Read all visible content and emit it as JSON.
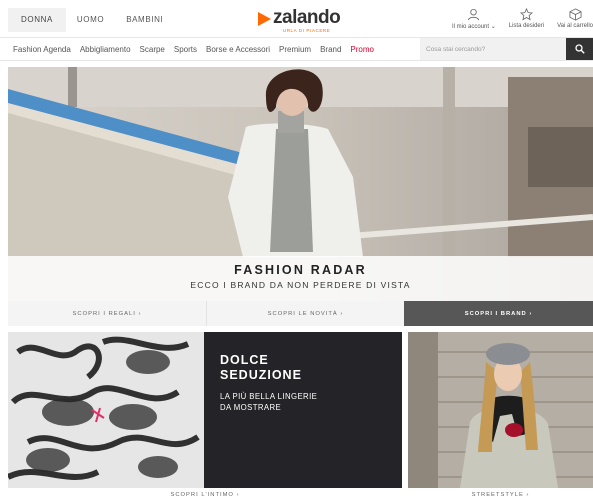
{
  "gender_tabs": [
    {
      "label": "DONNA",
      "active": true
    },
    {
      "label": "UOMO",
      "active": false
    },
    {
      "label": "BAMBINI",
      "active": false
    }
  ],
  "logo": {
    "text": "zalando",
    "subtitle": "URLA DI PIACERE",
    "color": "#ff6900"
  },
  "utilities": [
    {
      "label": "Il mio account",
      "icon": "user-icon"
    },
    {
      "label": "Lista desideri",
      "icon": "star-icon"
    },
    {
      "label": "Vai al carrello",
      "icon": "bag-icon"
    }
  ],
  "categories": [
    "Fashion Agenda",
    "Abbigliamento",
    "Scarpe",
    "Sports",
    "Borse e Accessori",
    "Premium",
    "Brand",
    "Promo"
  ],
  "search": {
    "placeholder": "Cosa stai cercando?",
    "button_icon": "search-icon"
  },
  "hero": {
    "title": "FASHION RADAR",
    "subtitle": "ECCO I BRAND DA NON PERDERE DI VISTA",
    "links": [
      "SCOPRI I REGALI",
      "SCOPRI LE NOVITÀ",
      "SCOPRI I BRAND"
    ]
  },
  "promo": {
    "title": "DOLCE\nSEDUZIONE",
    "text": "LA PIÙ BELLA LINGERIE\nDA MOSTRARE",
    "link": "SCOPRI L'INTIMO"
  },
  "streetstyle": {
    "link": "STREETSTYLE"
  },
  "colors": {
    "accent": "#ff6900",
    "promo_red": "#e4002b",
    "dark_tile": "#242428",
    "dark_button": "#575757"
  }
}
